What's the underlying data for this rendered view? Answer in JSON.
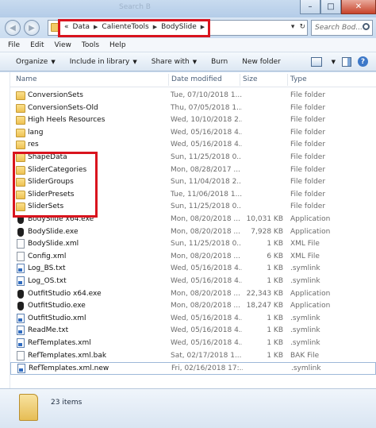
{
  "window": {
    "title": "Search B",
    "min_glyph": "–",
    "max_glyph": "□",
    "close_glyph": "✕"
  },
  "address_bar": {
    "prefix": "«",
    "crumbs": [
      "Data",
      "CalienteTools",
      "BodySlide"
    ],
    "dropdown_glyph": "▾",
    "refresh_glyph": "↻",
    "back_glyph": "◀",
    "forward_glyph": "▶"
  },
  "search": {
    "placeholder": "Search Bod..."
  },
  "menu": [
    "File",
    "Edit",
    "View",
    "Tools",
    "Help"
  ],
  "toolbar": {
    "organize": "Organize",
    "include": "Include in library",
    "share": "Share with",
    "burn": "Burn",
    "new_folder": "New folder",
    "help_glyph": "?"
  },
  "columns": {
    "name": "Name",
    "date": "Date modified",
    "size": "Size",
    "type": "Type"
  },
  "files": [
    {
      "name": "ConversionSets",
      "date": "Tue, 07/10/2018 1...",
      "size": "",
      "type": "File folder",
      "icon": "folder"
    },
    {
      "name": "ConversionSets-Old",
      "date": "Thu, 07/05/2018 1...",
      "size": "",
      "type": "File folder",
      "icon": "folder"
    },
    {
      "name": "High Heels Resources",
      "date": "Wed, 10/10/2018 2...",
      "size": "",
      "type": "File folder",
      "icon": "folder"
    },
    {
      "name": "lang",
      "date": "Wed, 05/16/2018 4...",
      "size": "",
      "type": "File folder",
      "icon": "folder"
    },
    {
      "name": "res",
      "date": "Wed, 05/16/2018 4...",
      "size": "",
      "type": "File folder",
      "icon": "folder"
    },
    {
      "name": "ShapeData",
      "date": "Sun, 11/25/2018 0...",
      "size": "",
      "type": "File folder",
      "icon": "folder"
    },
    {
      "name": "SliderCategories",
      "date": "Mon, 08/28/2017 ...",
      "size": "",
      "type": "File folder",
      "icon": "folder"
    },
    {
      "name": "SliderGroups",
      "date": "Sun, 11/04/2018 2...",
      "size": "",
      "type": "File folder",
      "icon": "folder"
    },
    {
      "name": "SliderPresets",
      "date": "Tue, 11/06/2018 1...",
      "size": "",
      "type": "File folder",
      "icon": "folder"
    },
    {
      "name": "SliderSets",
      "date": "Sun, 11/25/2018 0...",
      "size": "",
      "type": "File folder",
      "icon": "folder"
    },
    {
      "name": "BodySlide x64.exe",
      "date": "Mon, 08/20/2018 ...",
      "size": "10,031 KB",
      "type": "Application",
      "icon": "exe"
    },
    {
      "name": "BodySlide.exe",
      "date": "Mon, 08/20/2018 ...",
      "size": "7,928 KB",
      "type": "Application",
      "icon": "exe"
    },
    {
      "name": "BodySlide.xml",
      "date": "Sun, 11/25/2018 0...",
      "size": "1 KB",
      "type": "XML File",
      "icon": "file"
    },
    {
      "name": "Config.xml",
      "date": "Mon, 08/20/2018 ...",
      "size": "6 KB",
      "type": "XML File",
      "icon": "file"
    },
    {
      "name": "Log_BS.txt",
      "date": "Wed, 05/16/2018 4...",
      "size": "1 KB",
      "type": ".symlink",
      "icon": "link"
    },
    {
      "name": "Log_OS.txt",
      "date": "Wed, 05/16/2018 4...",
      "size": "1 KB",
      "type": ".symlink",
      "icon": "link"
    },
    {
      "name": "OutfitStudio x64.exe",
      "date": "Mon, 08/20/2018 ...",
      "size": "22,343 KB",
      "type": "Application",
      "icon": "exe"
    },
    {
      "name": "OutfitStudio.exe",
      "date": "Mon, 08/20/2018 ...",
      "size": "18,247 KB",
      "type": "Application",
      "icon": "exe"
    },
    {
      "name": "OutfitStudio.xml",
      "date": "Wed, 05/16/2018 4...",
      "size": "1 KB",
      "type": ".symlink",
      "icon": "link"
    },
    {
      "name": "ReadMe.txt",
      "date": "Wed, 05/16/2018 4...",
      "size": "1 KB",
      "type": ".symlink",
      "icon": "link"
    },
    {
      "name": "RefTemplates.xml",
      "date": "Wed, 05/16/2018 4...",
      "size": "1 KB",
      "type": ".symlink",
      "icon": "link"
    },
    {
      "name": "RefTemplates.xml.bak",
      "date": "Sat, 02/17/2018 1...",
      "size": "1 KB",
      "type": "BAK File",
      "icon": "file"
    },
    {
      "name": "RefTemplates.xml.new",
      "date": "Fri, 02/16/2018 17:...",
      "size": "",
      "type": ".symlink",
      "icon": "link"
    }
  ],
  "status": {
    "count": "23 items"
  },
  "colors": {
    "highlight": "#d9141e",
    "folder": "#f2c964",
    "accent": "#3c78c8"
  }
}
